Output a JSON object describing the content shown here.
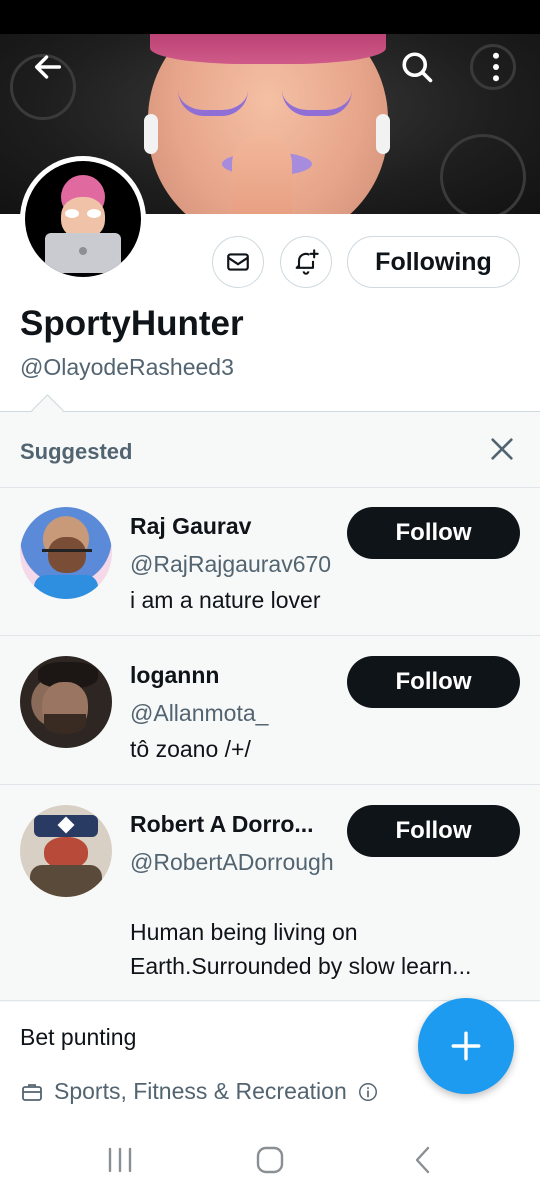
{
  "header": {
    "back_icon": "arrow-left-icon",
    "search_icon": "search-icon",
    "more_icon": "more-vertical-icon"
  },
  "profile": {
    "display_name": "SportyHunter",
    "handle": "@OlayodeRasheed3",
    "following_label": "Following",
    "message_icon": "envelope-icon",
    "notify_icon": "bell-plus-icon"
  },
  "suggested": {
    "title": "Suggested",
    "close_icon": "close-icon",
    "users": [
      {
        "name": "Raj Gaurav",
        "handle": "@RajRajgaurav670",
        "bio": "i am a nature lover",
        "button": "Follow"
      },
      {
        "name": "logannn",
        "handle": "@Allanmota_",
        "bio": "tô zoano /+/",
        "button": "Follow"
      },
      {
        "name": "Robert A Dorro...",
        "handle": "@RobertADorrough",
        "bio": "Human being living on Earth.Surrounded by slow learn...",
        "button": "Follow"
      }
    ]
  },
  "about": {
    "bio": "Bet punting",
    "category": "Sports, Fitness & Recreation",
    "category_icon": "briefcase-icon",
    "info_icon": "info-icon"
  },
  "fab": {
    "icon": "plus-icon"
  },
  "navbar": {
    "recents_icon": "recents-icon",
    "home_icon": "home-icon",
    "back_icon": "back-icon"
  },
  "colors": {
    "accent": "#1d9bf0",
    "text": "#0f1419",
    "muted": "#536471",
    "panel": "#f7f9f9"
  }
}
